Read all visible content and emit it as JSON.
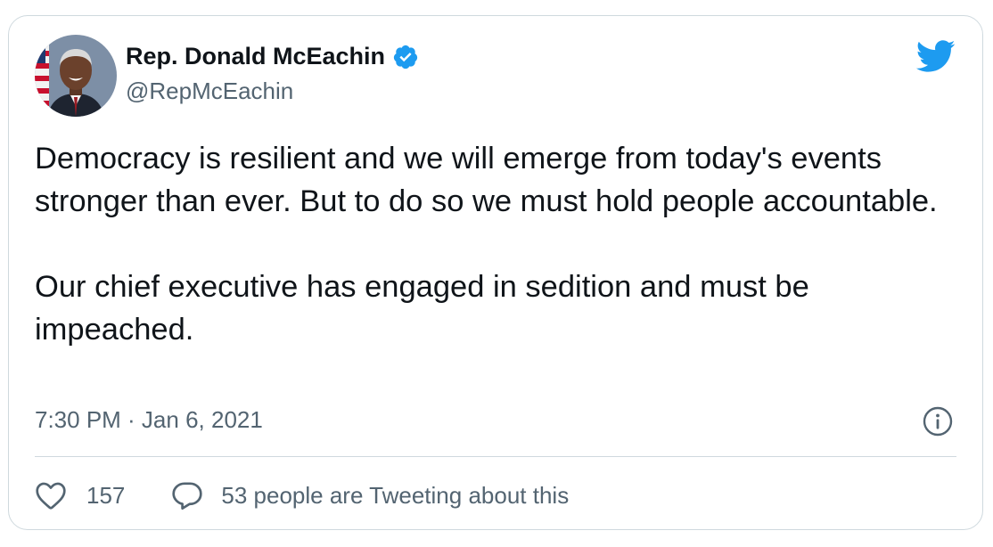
{
  "tweet": {
    "author_name": "Rep. Donald McEachin",
    "author_handle": "@RepMcEachin",
    "verified": true,
    "text": "Democracy is resilient and we will emerge from today's events stronger than ever. But to do so we must hold people accountable.\n\nOur chief executive has engaged in sedition and must be impeached.",
    "timestamp": "7:30 PM · Jan 6, 2021",
    "like_count": "157",
    "conversation_text": "53 people are Tweeting about this"
  },
  "icons": {
    "avatar": "avatar-photo",
    "verified": "verified-badge-icon",
    "brand": "twitter-bird-icon",
    "info": "info-icon",
    "like": "heart-icon",
    "reply": "speech-bubble-icon"
  },
  "colors": {
    "brand_blue": "#1d9bf0",
    "text_primary": "#0f1419",
    "text_secondary": "#536471",
    "border": "#cfd9de"
  }
}
